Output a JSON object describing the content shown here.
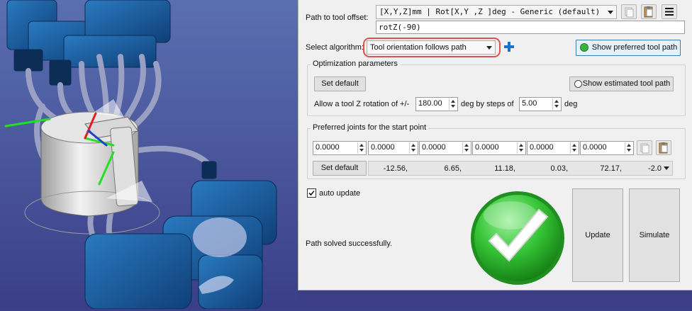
{
  "tool_offset": {
    "label": "Path to tool offset:",
    "format_selected": "[X,Y,Z]mm | Rot[X,Y ,Z  ]deg - Generic (default)",
    "value": "rotZ(-90)"
  },
  "algorithm": {
    "label": "Select algorithm:",
    "selected": "Tool orientation follows path",
    "add_icon": "plus-icon",
    "show_preferred_label": "Show preferred tool path"
  },
  "optimization": {
    "title": "Optimization parameters",
    "set_default_label": "Set default",
    "show_estimated_label": "Show estimated tool path",
    "rotation_label": "Allow a tool Z rotation of +/-",
    "rotation_value": "180.00",
    "steps_label": "deg by steps of",
    "steps_value": "5.00",
    "unit_label": "deg"
  },
  "preferred_joints": {
    "title": "Preferred joints for the start point",
    "inputs": [
      "0.0000",
      "0.0000",
      "0.0000",
      "0.0000",
      "0.0000",
      "0.0000"
    ],
    "set_default_label": "Set default",
    "current_values": [
      "-12.56,",
      "6.65,",
      "11.18,",
      "0.03,",
      "72.17,",
      "-2.0"
    ]
  },
  "auto_update": {
    "label": "auto update",
    "checked": true
  },
  "status": {
    "text": "Path solved successfully.",
    "icon": "success-check-icon"
  },
  "actions": {
    "update_label": "Update",
    "simulate_label": "Simulate"
  },
  "colors": {
    "accent_blue": "#1a72c9",
    "success_green": "#2fb12f",
    "highlight_red": "#e05050"
  }
}
